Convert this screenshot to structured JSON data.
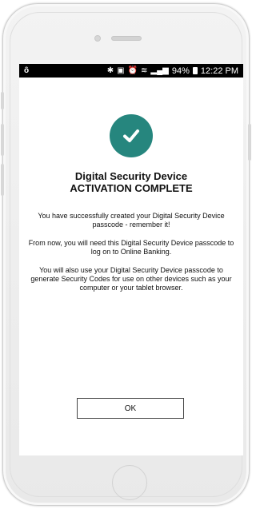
{
  "status_bar": {
    "left_icon": "notification-icon",
    "icons": [
      "bluetooth-icon",
      "nfc-icon",
      "alarm-icon",
      "wifi-icon",
      "signal-icon"
    ],
    "battery": "94%",
    "time": "12:22 PM"
  },
  "main": {
    "status_icon": "check-circle-icon",
    "accent_color": "#26867e",
    "title_line1": "Digital Security Device",
    "title_line2": "ACTIVATION COMPLETE",
    "paragraphs": [
      "You have successfully created your Digital Security Device passcode - remember it!",
      "From now, you will need this Digital Security Device passcode to log on to Online Banking.",
      "You will also use your Digital Security Device passcode to generate Security Codes for use on other devices such as your computer or your tablet browser."
    ],
    "ok_label": "OK"
  }
}
